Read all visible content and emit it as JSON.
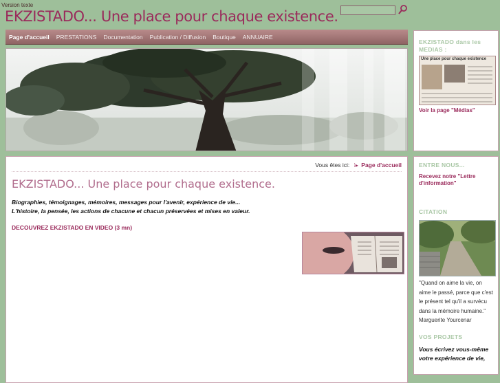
{
  "header": {
    "text_version": "Version texte",
    "site_title": "EKZISTADO... Une place pour chaque existence."
  },
  "nav": {
    "items": [
      {
        "label": "Page d'accueil",
        "active": true
      },
      {
        "label": "PRESTATIONS",
        "active": false
      },
      {
        "label": "Documentation",
        "active": false
      },
      {
        "label": "Publication / Diffusion",
        "active": false
      },
      {
        "label": "Boutique",
        "active": false
      },
      {
        "label": "ANNUAIRE",
        "active": false
      }
    ]
  },
  "main": {
    "breadcrumb_prefix": "Vous êtes ici:",
    "breadcrumb_current": "Page d'accueil",
    "page_title": "EKZISTADO... Une place pour chaque existence.",
    "intro_line1": "Biographies, témoignages, mémoires, messages pour l'avenir, expérience de vie...",
    "intro_line2": "L'histoire, la pensée, les actions de chacune et chacun préservées et mises en valeur.",
    "video_link": "DECOUVREZ EKZISTADO EN VIDEO (3 mn)"
  },
  "sidebar": {
    "medias": {
      "title": "EKZISTADO dans les MEDIAS :",
      "clipping_headline": "Une place pour chaque existence",
      "link": "Voir la page \"Médias\""
    },
    "entre_nous": {
      "title": "ENTRE NOUS...",
      "link": "Recevez notre \"Lettre d'information\""
    },
    "citation": {
      "title": "CITATION",
      "quote": "\"Quand on aime la vie, on aime le passé, parce que c'est le présent tel qu'il a survécu dans la mémoire humaine.\"",
      "author": "Marguerite Yourcenar"
    },
    "projets": {
      "title": "VOS PROJETS",
      "text": "Vous écrivez vous-même votre expérience de vie,"
    }
  },
  "colors": {
    "background": "#9ebf9a",
    "brand": "#9a2a5b",
    "nav": "#a57575",
    "section_title": "#a9c7a5"
  }
}
